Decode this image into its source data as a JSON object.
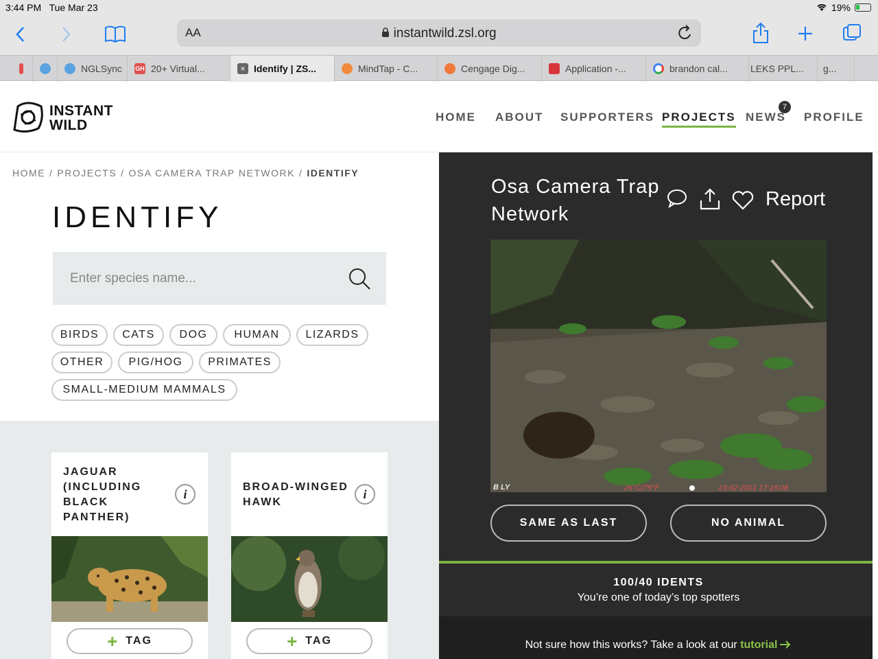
{
  "status_bar": {
    "time": "3:44 PM",
    "date": "Tue Mar 23",
    "battery": "19%"
  },
  "browser": {
    "text_size_label": "AA",
    "url": "instantwild.zsl.org",
    "tabs": [
      {
        "label": "NGLSync",
        "color": "#5aa3e0"
      },
      {
        "label": "20+ Virtual...",
        "color": "#e05050",
        "icon_text": "GH"
      },
      {
        "label": "Identify | ZS...",
        "color": "#555555",
        "active": true
      },
      {
        "label": "MindTap - C...",
        "color": "#f08a3c"
      },
      {
        "label": "Cengage Dig...",
        "color": "#f0783c"
      },
      {
        "label": "Application -...",
        "color": "#d8343c"
      },
      {
        "label": "brandon cal...",
        "color": "#4285f4"
      },
      {
        "label": "LEKS PPL...",
        "color": "#888888"
      },
      {
        "label": "g...",
        "color": "#888888"
      }
    ]
  },
  "site": {
    "logo_line1": "INSTANT",
    "logo_line2": "WILD",
    "nav": [
      "HOME",
      "ABOUT",
      "SUPPORTERS",
      "PROJECTS",
      "NEWS",
      "PROFILE"
    ],
    "news_badge": "7",
    "accent": "#7cb342"
  },
  "identify": {
    "breadcrumb": [
      "HOME",
      "PROJECTS",
      "OSA CAMERA TRAP NETWORK",
      "IDENTIFY"
    ],
    "title": "IDENTIFY",
    "search_placeholder": "Enter species name...",
    "filters": [
      "BIRDS",
      "CATS",
      "DOG",
      "HUMAN",
      "LIZARDS",
      "OTHER",
      "PIG/HOG",
      "PRIMATES",
      "SMALL-MEDIUM MAMMALS"
    ],
    "cards": [
      {
        "name": "JAGUAR (INCLUDING BLACK PANTHER)",
        "tag": "TAG"
      },
      {
        "name": "BROAD-WINGED HAWK",
        "tag": "TAG"
      }
    ]
  },
  "project": {
    "name": "Osa Camera Trap Network",
    "report_label": "Report",
    "photo_stamp_left": "B  LY",
    "photo_stamp_temp": "26°C/79°F",
    "photo_stamp_date": "23-02-2021 17:16:08",
    "same_as_last": "SAME AS LAST",
    "no_animal": "NO ANIMAL",
    "idents_count": "100/40 IDENTS",
    "idents_sub": "You’re one of today’s top spotters",
    "tutorial_text": "Not sure how this works? Take a look at our",
    "tutorial_link": "tutorial"
  }
}
